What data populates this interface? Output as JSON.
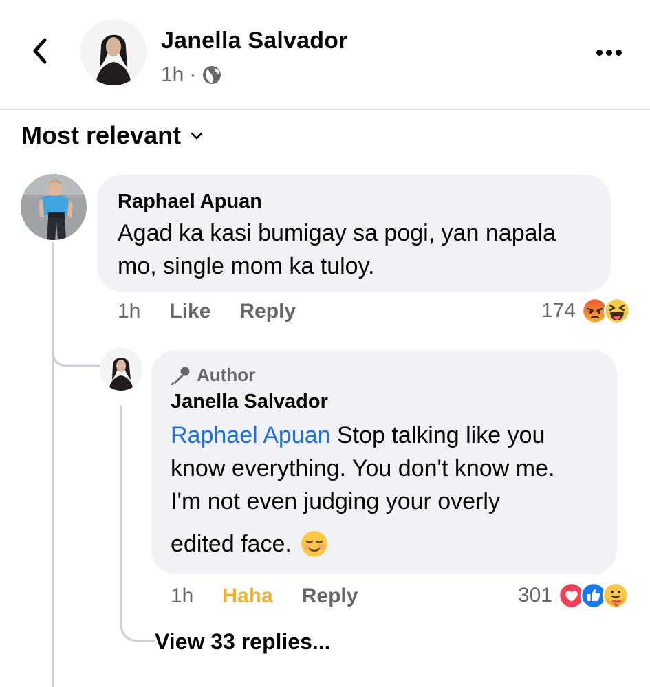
{
  "header": {
    "name": "Janella Salvador",
    "time": "1h",
    "separator": "·",
    "back_icon": "chevron-left-icon",
    "more_icon": "more-horizontal-icon",
    "privacy_icon": "globe-icon"
  },
  "sort": {
    "label": "Most relevant",
    "icon": "chevron-down-icon"
  },
  "comments": [
    {
      "author": "Raphael Apuan",
      "lines": [
        "Agad ka kasi bumigay sa pogi, yan napala",
        "mo, single mom ka tuloy."
      ],
      "time": "1h",
      "like_label": "Like",
      "reply_label": "Reply",
      "reaction_count": "174",
      "reactions": [
        "angry",
        "haha"
      ]
    },
    {
      "badge": "Author",
      "badge_icon": "microphone-icon",
      "author": "Janella Salvador",
      "mention": "Raphael Apuan",
      "lines": [
        "Stop talking like you",
        "know everything. You don't know me.",
        "I'm not even judging your overly",
        "edited face."
      ],
      "trailing_emoji": "☺️",
      "time": "1h",
      "like_label": "Haha",
      "reply_label": "Reply",
      "reaction_count": "301",
      "reactions": [
        "love",
        "like",
        "care"
      ]
    }
  ],
  "view_replies": "View 33 replies...",
  "colors": {
    "accent_link": "#216fdb",
    "haha_active": "#f0b330",
    "bubble_bg": "#f0f2f5",
    "secondary_text": "#65676b"
  }
}
